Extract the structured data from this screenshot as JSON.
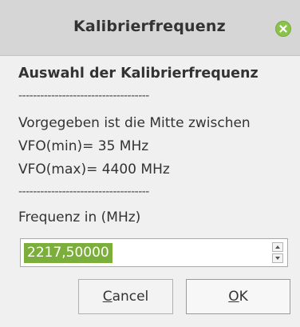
{
  "window": {
    "title": "Kalibrierfrequenz",
    "close_icon": "close-icon"
  },
  "content": {
    "heading": "Auswahl der Kalibrierfrequenz",
    "separator": "------------------------------------",
    "info_line": "Vorgegeben ist die Mitte zwischen",
    "vfo_min": "VFO(min)= 35 MHz",
    "vfo_max": "VFO(max)= 4400 MHz",
    "input_label": "Frequenz in (MHz)"
  },
  "spinbox": {
    "value": "2217,50000"
  },
  "buttons": {
    "cancel_mnemonic": "C",
    "cancel_rest": "ancel",
    "ok_mnemonic": "O",
    "ok_rest": "K"
  },
  "colors": {
    "accent": "#8bc34a",
    "selection": "#7cae3c",
    "titlebar": "#d6d6d6",
    "background": "#f0f0f0"
  }
}
